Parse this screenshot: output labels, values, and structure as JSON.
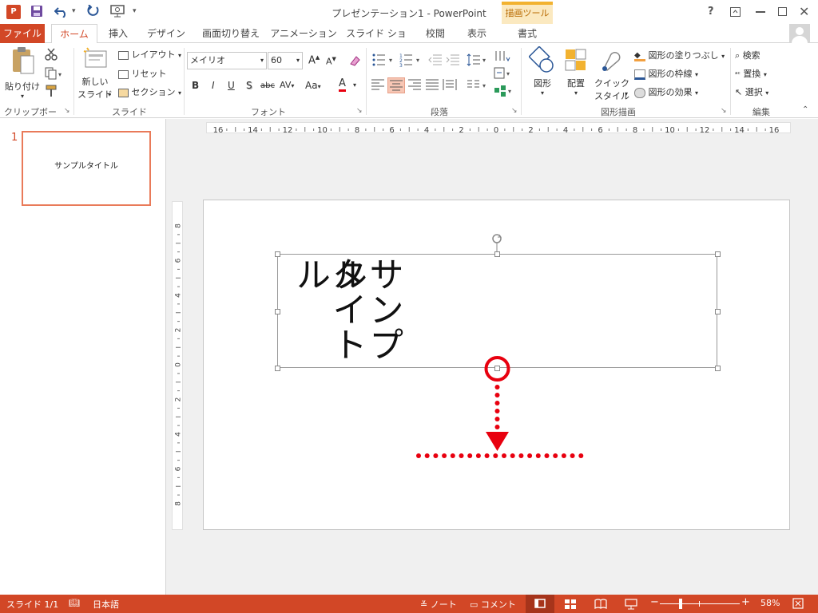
{
  "titlebar": {
    "title": "プレゼンテーション1 - PowerPoint",
    "help_icon": "?",
    "window_controls": [
      "restore-ribbon",
      "minimize",
      "maximize",
      "close"
    ]
  },
  "tabs": {
    "file": "ファイル",
    "home": "ホーム",
    "insert": "挿入",
    "design": "デザイン",
    "transitions": "画面切り替え",
    "animations": "アニメーション",
    "slideshow": "スライド ショー",
    "review": "校閲",
    "view": "表示",
    "context_title": "描画ツール",
    "format": "書式"
  },
  "ribbon": {
    "paste": "貼り付け",
    "new_slide": "新しい\nスライド",
    "new_slide_l1": "新しい",
    "new_slide_l2": "スライド",
    "layout": "レイアウト",
    "reset": "リセット",
    "section": "セクション",
    "font_name": "メイリオ",
    "font_size": "60",
    "shapes": "図形",
    "arrange": "配置",
    "quick_style_l1": "クイック",
    "quick_style_l2": "スタイル",
    "fill": "図形の塗りつぶし",
    "outline": "図形の枠線",
    "effects": "図形の効果",
    "find": "検索",
    "replace": "置換",
    "select": "選択",
    "groups": {
      "clipboard": "クリップボード",
      "slides": "スライド",
      "font": "フォント",
      "paragraph": "段落",
      "drawing": "図形描画",
      "editing": "編集"
    }
  },
  "thumbnail": {
    "number": "1",
    "title": "サンプルタイトル"
  },
  "slide": {
    "text_col1": "サンプル",
    "text_col2": "タイト",
    "text_col3": "ル"
  },
  "ruler_h": [
    "16",
    "14",
    "12",
    "10",
    "8",
    "6",
    "4",
    "2",
    "0",
    "2",
    "4",
    "6",
    "8",
    "10",
    "12",
    "14",
    "16"
  ],
  "ruler_v": [
    "8",
    "6",
    "4",
    "2",
    "0",
    "2",
    "4",
    "6",
    "8"
  ],
  "status": {
    "slide": "スライド 1/1",
    "lang": "日本語",
    "notes": "ノート",
    "comments": "コメント",
    "zoom": "58%"
  },
  "colors": {
    "accent": "#d24726",
    "annotation": "#e8000f"
  }
}
